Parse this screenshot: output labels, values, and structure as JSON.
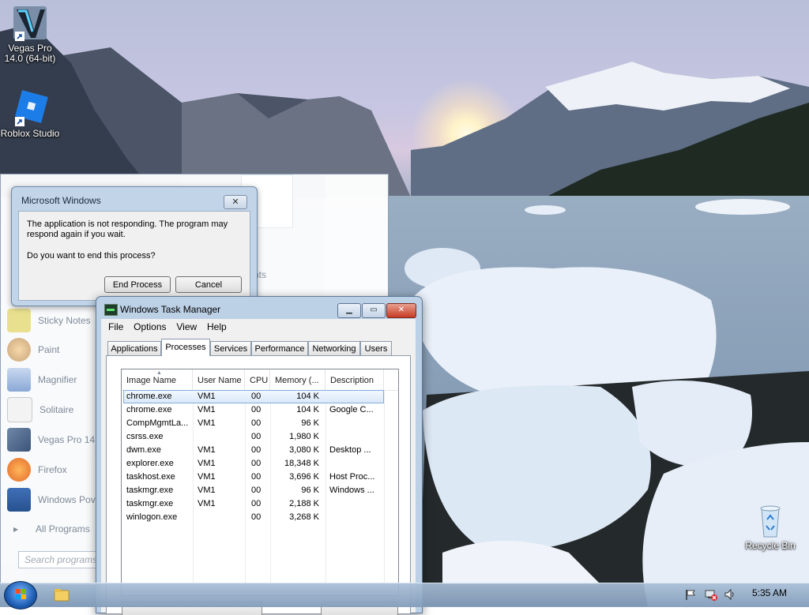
{
  "desktop": {
    "icons": [
      {
        "label_1": "Vegas Pro",
        "label_2": "14.0 (64-bit)"
      },
      {
        "label_1": "Roblox Studio"
      },
      {
        "label_1": "Recycle Bin"
      }
    ]
  },
  "start_menu": {
    "items": [
      "Sticky Notes",
      "Paint",
      "Magnifier",
      "Solitaire",
      "Vegas Pro 14.",
      "Firefox",
      "Windows Pov"
    ],
    "all_programs": "All Programs",
    "search_placeholder": "Search programs",
    "fragment": "nts"
  },
  "dialog": {
    "title": "Microsoft Windows",
    "close_glyph": "✕",
    "message": "The application is not responding. The program may respond again if you wait.",
    "question": "Do you want to end this process?",
    "end_process": "End Process",
    "cancel": "Cancel"
  },
  "task_manager": {
    "title": "Windows Task Manager",
    "menu": [
      "File",
      "Options",
      "View",
      "Help"
    ],
    "tabs": [
      "Applications",
      "Processes",
      "Services",
      "Performance",
      "Networking",
      "Users"
    ],
    "active_tab": "Processes",
    "columns": [
      "Image Name",
      "User Name",
      "CPU",
      "Memory (...",
      "Description"
    ],
    "processes": [
      {
        "image": "chrome.exe",
        "user": "VM1",
        "cpu": "00",
        "memory": "104 K",
        "description": ""
      },
      {
        "image": "chrome.exe",
        "user": "VM1",
        "cpu": "00",
        "memory": "104 K",
        "description": "Google C..."
      },
      {
        "image": "CompMgmtLa...",
        "user": "VM1",
        "cpu": "00",
        "memory": "96 K",
        "description": ""
      },
      {
        "image": "csrss.exe",
        "user": "",
        "cpu": "00",
        "memory": "1,980 K",
        "description": ""
      },
      {
        "image": "dwm.exe",
        "user": "VM1",
        "cpu": "00",
        "memory": "3,080 K",
        "description": "Desktop ..."
      },
      {
        "image": "explorer.exe",
        "user": "VM1",
        "cpu": "00",
        "memory": "18,348 K",
        "description": ""
      },
      {
        "image": "taskhost.exe",
        "user": "VM1",
        "cpu": "00",
        "memory": "3,696 K",
        "description": "Host Proc..."
      },
      {
        "image": "taskmgr.exe",
        "user": "VM1",
        "cpu": "00",
        "memory": "96 K",
        "description": "Windows ..."
      },
      {
        "image": "taskmgr.exe",
        "user": "VM1",
        "cpu": "00",
        "memory": "2,188 K",
        "description": ""
      },
      {
        "image": "winlogon.exe",
        "user": "",
        "cpu": "00",
        "memory": "3,268 K",
        "description": ""
      }
    ],
    "selected_row": 0
  },
  "taskbar": {
    "clock": "5:35 AM"
  }
}
